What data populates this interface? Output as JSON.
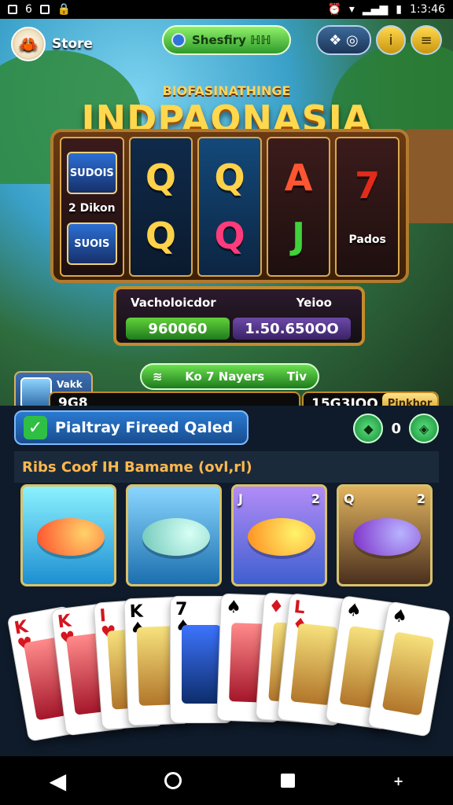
{
  "status_bar": {
    "left_icons": [
      "A",
      "S",
      "⌧",
      "🔒"
    ],
    "time": "1:3:46"
  },
  "header": {
    "store_label": "Store",
    "status_pill": "Shesfiry ℍℍ",
    "icons": {
      "leaf_settings": "❖ ◎",
      "info": "i",
      "menu": "≡"
    }
  },
  "title": {
    "small": "BIOFASINATHINGE",
    "big": "INDPAONASIA"
  },
  "reels": {
    "left_panel": {
      "tile_1": "SUDOIS",
      "label": "2 Dikon",
      "tile_2": "SUOIS"
    },
    "col_1": [
      "Q",
      "Q"
    ],
    "col_2": [
      "Q",
      "Q"
    ],
    "col_3": [
      "A",
      "J"
    ],
    "col_4": [
      "7",
      "Pados"
    ]
  },
  "info_panel": {
    "left_label": "Vacholoicdor",
    "right_label": "Yeioo",
    "left_value": "960060",
    "right_value": "1.50.650OO"
  },
  "players_bar": {
    "left_icon": "≋",
    "text": "Ko 7 Nayers",
    "right_text": "Tiv"
  },
  "bottom_bar": {
    "user_label": "Vakk",
    "balance": "9G8",
    "coins": "15G3IOO",
    "coin_button": "Pinkhor"
  },
  "lower": {
    "primary_button": "Pialtray Fireed Qaled",
    "counter": "0",
    "section_title": "Ribs Coof IH Bamame (ovl,rl)"
  },
  "game_cards": [
    {
      "label": "",
      "alt_label": ""
    },
    {
      "label": "",
      "alt_label": ""
    },
    {
      "label": "J",
      "alt_label": "2"
    },
    {
      "label": "Q",
      "alt_label": "2"
    }
  ],
  "playing_cards": [
    {
      "rank": "K",
      "suit": "♥"
    },
    {
      "rank": "K",
      "suit": "♥"
    },
    {
      "rank": "I",
      "suit": "♥"
    },
    {
      "rank": "K",
      "suit": "♠"
    },
    {
      "rank": "7",
      "suit": "♠"
    },
    {
      "rank": "",
      "suit": "♠"
    },
    {
      "rank": "",
      "suit": "♦"
    },
    {
      "rank": "L",
      "suit": "♦"
    },
    {
      "rank": "",
      "suit": "♠"
    },
    {
      "rank": "",
      "suit": "♠"
    }
  ],
  "nav": {
    "more": "+"
  }
}
